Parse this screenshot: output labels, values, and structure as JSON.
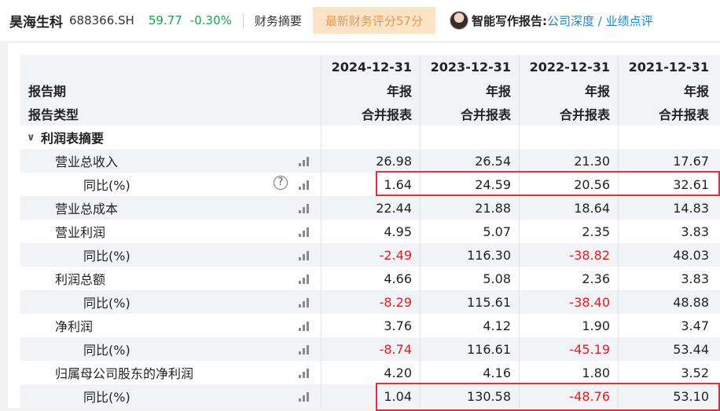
{
  "header": {
    "stock_name": "昊海生科",
    "stock_code": "688366.SH",
    "price": "59.77",
    "change": "-0.30%",
    "tab_summary": "财务摘要",
    "score_chip": "最新财务评分57分",
    "report_title": "智能写作报告:",
    "report_links": "公司深度 / 业绩点评"
  },
  "table": {
    "periods": [
      "2024-12-31",
      "2023-12-31",
      "2022-12-31",
      "2021-12-31"
    ],
    "report_period_label": "报告期",
    "report_type_label": "报告类型",
    "period_types": [
      "年报",
      "年报",
      "年报",
      "年报"
    ],
    "statement_types": [
      "合并报表",
      "合并报表",
      "合并报表",
      "合并报表"
    ],
    "section_label": "利润表摘要",
    "rows": [
      {
        "label": "营业总收入",
        "values": [
          "26.98",
          "26.54",
          "21.30",
          "17.67"
        ]
      },
      {
        "label": "同比(%)",
        "values": [
          "1.64",
          "24.59",
          "20.56",
          "32.61"
        ]
      },
      {
        "label": "营业总成本",
        "values": [
          "22.44",
          "21.88",
          "18.64",
          "14.83"
        ]
      },
      {
        "label": "营业利润",
        "values": [
          "4.95",
          "5.07",
          "2.35",
          "3.83"
        ]
      },
      {
        "label": "同比(%)",
        "values": [
          "-2.49",
          "116.30",
          "-38.82",
          "48.03"
        ]
      },
      {
        "label": "利润总额",
        "values": [
          "4.66",
          "5.08",
          "2.36",
          "3.83"
        ]
      },
      {
        "label": "同比(%)",
        "values": [
          "-8.29",
          "115.61",
          "-38.40",
          "48.88"
        ]
      },
      {
        "label": "净利润",
        "values": [
          "3.76",
          "4.12",
          "1.90",
          "3.47"
        ]
      },
      {
        "label": "同比(%)",
        "values": [
          "-8.74",
          "116.61",
          "-45.19",
          "53.44"
        ]
      },
      {
        "label": "归属母公司股东的净利润",
        "values": [
          "4.20",
          "4.16",
          "1.80",
          "3.52"
        ]
      },
      {
        "label": "同比(%)",
        "values": [
          "1.04",
          "130.58",
          "-48.76",
          "53.10"
        ]
      }
    ]
  },
  "colors": {
    "positive_change": "#1a9f4a",
    "negative_value": "#e0201f",
    "link": "#1d87c9",
    "highlight_box": "#e22d3a",
    "score_chip_bg": "#fbe3c8"
  },
  "icons": [
    "chart-icon",
    "help-icon",
    "chevron-down-icon",
    "avatar"
  ]
}
